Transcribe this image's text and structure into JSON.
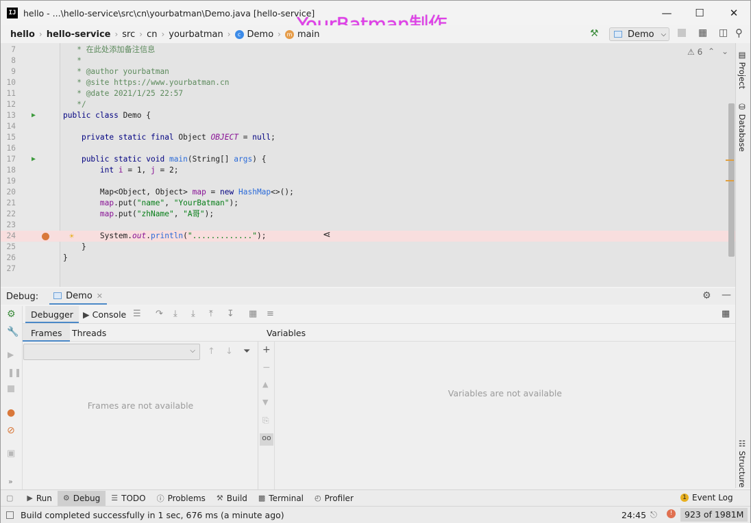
{
  "window": {
    "title": "hello - ...\\hello-service\\src\\cn\\yourbatman\\Demo.java [hello-service]",
    "watermark": "YourBatman制作",
    "app_icon": "IJ"
  },
  "navbar": {
    "crumbs": [
      "hello",
      "hello-service",
      "src",
      "cn",
      "yourbatman",
      "Demo",
      "main"
    ],
    "run_config": "Demo"
  },
  "editor": {
    "inspections_count": "6",
    "lines": [
      {
        "num": "7",
        "html": "<span class='cm'>   * 在此处添加备注信息</span>"
      },
      {
        "num": "8",
        "html": "<span class='cm'>   *</span>"
      },
      {
        "num": "9",
        "html": "<span class='cm'>   * @author yourbatman</span>"
      },
      {
        "num": "10",
        "html": "<span class='cm'>   * @site https://www.yourbatman.cn</span>"
      },
      {
        "num": "11",
        "html": "<span class='cm'>   * @date 2021/1/25 22:57</span>"
      },
      {
        "num": "12",
        "html": "<span class='cm'>   */</span>"
      },
      {
        "num": "13",
        "html": "<span class='kw'>public class</span> Demo {"
      },
      {
        "num": "14",
        "html": ""
      },
      {
        "num": "15",
        "html": "    <span class='kw'>private static final</span> Object <span class='fld'>OBJECT</span> = <span class='kw'>null</span>;"
      },
      {
        "num": "16",
        "html": ""
      },
      {
        "num": "17",
        "html": "    <span class='kw'>public static void</span> <span class='mth'>main</span>(String[] <span class='par'>args</span>) {"
      },
      {
        "num": "18",
        "html": "        <span class='kw'>int</span> <span class='var'>i</span> = 1, <span class='var'>j</span> = 2;"
      },
      {
        "num": "19",
        "html": ""
      },
      {
        "num": "20",
        "html": "        Map&lt;Object, Object&gt; <span class='var'>map</span> = <span class='kw'>new</span> <span class='mth'>HashMap</span>&lt;&gt;();"
      },
      {
        "num": "21",
        "html": "        <span class='var'>map</span>.put(<span class='str'>\"name\"</span>, <span class='str'>\"YourBatman\"</span>);"
      },
      {
        "num": "22",
        "html": "        <span class='var'>map</span>.put(<span class='str'>\"zhName\"</span>, <span class='str'>\"A哥\"</span>);"
      },
      {
        "num": "23",
        "html": ""
      },
      {
        "num": "24",
        "html": "        System.<span class='fld'>out</span>.<span class='mth'>println</span>(<span class='str'>\".............\"</span>);"
      },
      {
        "num": "25",
        "html": "    }"
      },
      {
        "num": "26",
        "html": "}"
      },
      {
        "num": "27",
        "html": ""
      }
    ],
    "highlight_line": "24",
    "run_gutter_lines": [
      "13",
      "17"
    ],
    "breakpoint_line": "24"
  },
  "right_tabs": {
    "project": "Project",
    "database": "Database",
    "structure": "Structure"
  },
  "debug": {
    "label": "Debug:",
    "session_tab": "Demo",
    "debugger_tab": "Debugger",
    "console_tab": "Console",
    "frames_tab": "Frames",
    "threads_tab": "Threads",
    "variables_header": "Variables",
    "frames_empty": "Frames are not available",
    "variables_empty": "Variables are not available"
  },
  "bottom_tabs": [
    {
      "label": "Run",
      "icon": "run-icon"
    },
    {
      "label": "Debug",
      "icon": "bug-icon",
      "active": true
    },
    {
      "label": "TODO",
      "icon": "list-icon"
    },
    {
      "label": "Problems",
      "icon": "warning-icon"
    },
    {
      "label": "Build",
      "icon": "hammer-icon"
    },
    {
      "label": "Terminal",
      "icon": "terminal-icon"
    },
    {
      "label": "Profiler",
      "icon": "profiler-icon"
    }
  ],
  "event_log": {
    "count": "1",
    "label": "Event Log"
  },
  "status": {
    "message": "Build completed successfully in 1 sec, 676 ms (a minute ago)",
    "position": "24:45",
    "memory": "923 of 1981M"
  },
  "colors": {
    "highlight_line": "#f8dede",
    "breakpoint": "#d9783a",
    "watermark": "#e040e8"
  }
}
